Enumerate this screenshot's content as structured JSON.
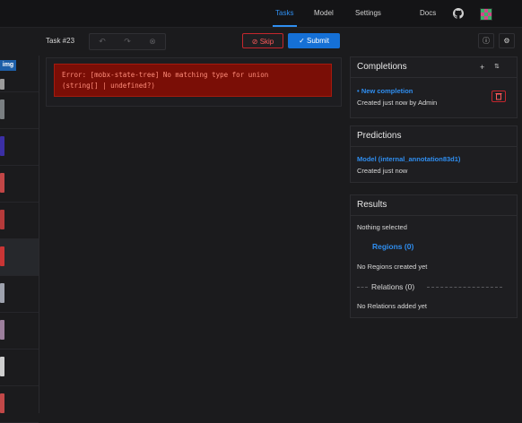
{
  "nav": {
    "tasks": "Tasks",
    "model": "Model",
    "settings": "Settings",
    "docs": "Docs"
  },
  "toolbar": {
    "task_label": "Task #23",
    "skip": "Skip",
    "submit": "Submit",
    "undo_icon": "undo-icon",
    "redo_icon": "redo-icon",
    "reset_icon": "reset-icon"
  },
  "left": {
    "img_button": "img"
  },
  "error": {
    "line1": "Error: [mobx-state-tree] No matching type for union",
    "line2": "(string[] | undefined?)"
  },
  "completions": {
    "title": "Completions",
    "item_title": "New completion",
    "item_meta": "Created just now by Admin"
  },
  "predictions": {
    "title": "Predictions",
    "model_name": "Model (internal_annotation83d1)",
    "meta": "Created just now"
  },
  "results": {
    "title": "Results",
    "nothing_selected": "Nothing selected",
    "regions_label": "Regions (0)",
    "no_regions": "No Regions created yet",
    "relations_label": "Relations (0)",
    "no_relations": "No Relations added yet"
  },
  "colors": {
    "accent": "#2f8ef0",
    "danger": "#c4262d",
    "error_bg": "#7a0e06"
  },
  "thumbs": [
    "#9c9c9c",
    "#7a7f82",
    "#3b2fa5",
    "#c24646",
    "#b53a3a",
    "#c93535",
    "#9ea2ae",
    "#9c7f9c",
    "#cfcfcf",
    "#c24848"
  ]
}
